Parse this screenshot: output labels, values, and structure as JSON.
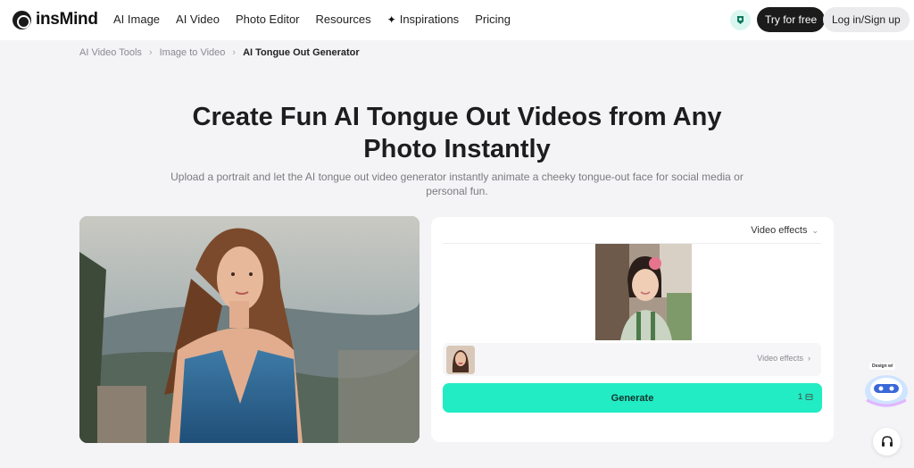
{
  "header": {
    "logo_text": "insMind",
    "nav": [
      "AI Image",
      "AI Video",
      "Photo Editor",
      "Resources",
      "Inspirations",
      "Pricing"
    ],
    "try_label": "Try for free",
    "login_label": "Log in/Sign up"
  },
  "breadcrumb": [
    "AI Video Tools",
    "Image to Video",
    "AI Tongue Out Generator"
  ],
  "hero": {
    "title_line1": "Create Fun AI Tongue Out Videos from Any",
    "title_line2": "Photo Instantly",
    "subtitle": "Upload a portrait and let the AI tongue out video generator instantly animate a cheeky tongue-out face for social media or personal fun."
  },
  "panel": {
    "effects_dropdown": "Video effects",
    "effects_row": "Video effects",
    "generate_label": "Generate",
    "generate_cost": "1"
  },
  "floating": {
    "mascot_label": "Design w/"
  },
  "colors": {
    "accent": "#22ecc4",
    "dark": "#1b1b1b"
  }
}
